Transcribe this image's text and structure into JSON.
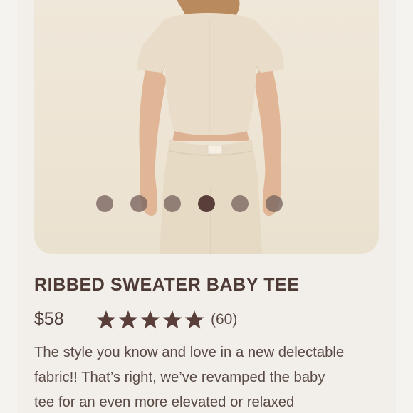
{
  "product": {
    "title": "RIBBED SWEATER BABY TEE",
    "price": "$58",
    "rating": 5,
    "rating_max": 5,
    "review_count": "(60)",
    "description_lines": [
      "The style you know and love in a new delectable",
      "fabric!! That’s right, we’ve revamped the baby",
      "tee for an even more elevated or relaxed"
    ]
  },
  "gallery": {
    "slide_count": 6,
    "active_index": 3
  },
  "colors": {
    "text_dark": "#4d3a35",
    "star": "#5a3e3a",
    "dot": "#78645f",
    "dot_active": "#5a3e3a",
    "card_bg": "#f2efea",
    "hero_bg": "#ede4d4"
  }
}
